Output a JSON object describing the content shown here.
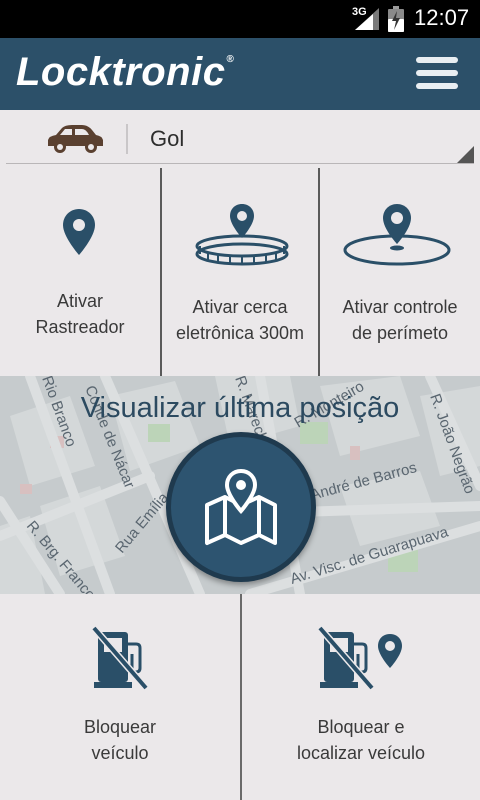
{
  "status_bar": {
    "network": "3G",
    "time": "12:07",
    "icons": [
      "signal-icon",
      "battery-icon"
    ]
  },
  "app_bar": {
    "logo_text": "Locktronic",
    "logo_mark": "®",
    "menu_icon": "hamburger-menu-icon"
  },
  "vehicle_selector": {
    "icon": "car-icon",
    "selected_value": "Gol"
  },
  "actions_top": [
    {
      "line1": "Ativar",
      "line2": "Rastreador",
      "icon": "map-pin-icon"
    },
    {
      "line1": "Ativar cerca",
      "line2": "eletrônica 300m",
      "icon": "geofence-fence-pin-icon"
    },
    {
      "line1": "Ativar controle",
      "line2": "de perímeto",
      "icon": "perimeter-pin-icon"
    }
  ],
  "map_banner": {
    "title": "Visualizar última posição",
    "button_icon": "map-location-icon",
    "street_labels": [
      "Rio Branco",
      "Conde de Nácar",
      "R. Brg. Franco",
      "Rua Emília",
      "R. Marechal",
      "R. Monteiro",
      "R. João Negrão",
      "André de Barros",
      "Av. Visc. de Guarapuava"
    ]
  },
  "actions_bottom": [
    {
      "line1": "Bloquear",
      "line2": "veículo",
      "icon": "block-fuel-icon"
    },
    {
      "line1": "Bloquear e",
      "line2": "localizar veículo",
      "icon": "block-fuel-locate-icon"
    }
  ],
  "colors": {
    "primary": "#2c5069",
    "icon": "#2a4f68",
    "background": "#ebe8ea",
    "map_bg": "#c6cbcd"
  }
}
